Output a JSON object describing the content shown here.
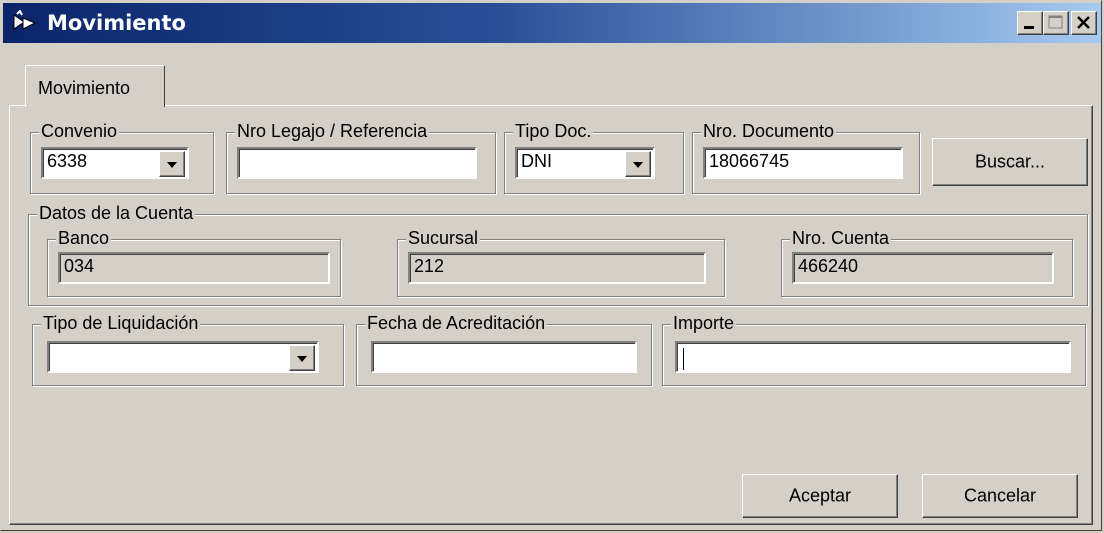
{
  "window": {
    "title": "Movimiento",
    "controls": [
      "minimize-icon",
      "maximize-icon",
      "close-icon"
    ]
  },
  "tabs": [
    {
      "label": "Movimiento",
      "active": true
    }
  ],
  "convenio": {
    "label": "Convenio",
    "value": "6338"
  },
  "legajo": {
    "label": "Nro Legajo / Referencia",
    "value": ""
  },
  "tipo_doc": {
    "label": "Tipo Doc.",
    "value": "DNI"
  },
  "nro_documento": {
    "label": "Nro. Documento",
    "value": "18066745"
  },
  "buscar_label": "Buscar...",
  "cuenta": {
    "label": "Datos de la Cuenta",
    "banco": {
      "label": "Banco",
      "value": "034"
    },
    "sucursal": {
      "label": "Sucursal",
      "value": "212"
    },
    "nro_cuenta": {
      "label": "Nro. Cuenta",
      "value": "466240"
    }
  },
  "tipo_liquidacion": {
    "label": "Tipo de Liquidación",
    "value": ""
  },
  "fecha_acreditacion": {
    "label": "Fecha de Acreditación",
    "value": ""
  },
  "importe": {
    "label": "Importe",
    "value": ""
  },
  "aceptar_label": "Aceptar",
  "cancelar_label": "Cancelar"
}
